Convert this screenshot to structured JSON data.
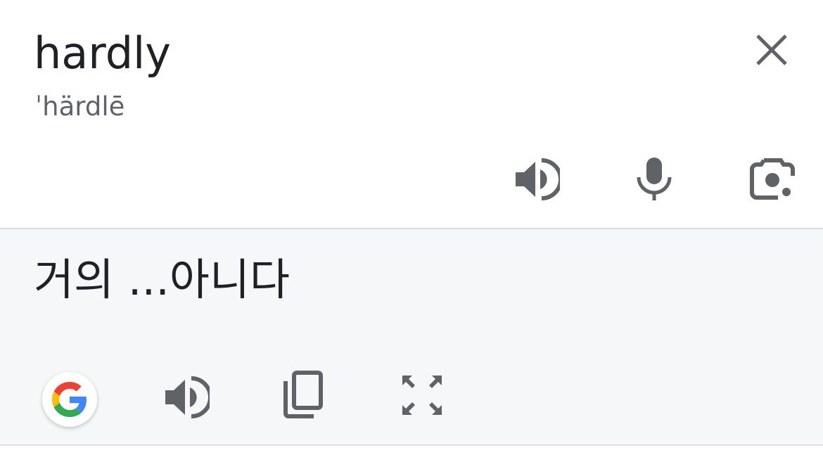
{
  "source": {
    "word": "hardly",
    "phonetic": "ˈhärdlē"
  },
  "source_toolbar": {
    "close_icon": "close-icon",
    "listen_icon": "volume-icon",
    "mic_icon": "microphone-icon",
    "camera_icon": "camera-lens-icon"
  },
  "result": {
    "text": "거의 ...아니다"
  },
  "result_toolbar": {
    "google_icon": "google-logo-icon",
    "listen_icon": "volume-icon",
    "copy_icon": "copy-icon",
    "fullscreen_icon": "fullscreen-icon"
  },
  "colors": {
    "text_primary": "#202124",
    "text_secondary": "#5f6368",
    "icon_gray": "#5f6368",
    "result_bg": "#f6f7f8",
    "divider": "#dadce0",
    "google_blue": "#4285F4",
    "google_red": "#EA4335",
    "google_yellow": "#FBBC05",
    "google_green": "#34A853"
  }
}
